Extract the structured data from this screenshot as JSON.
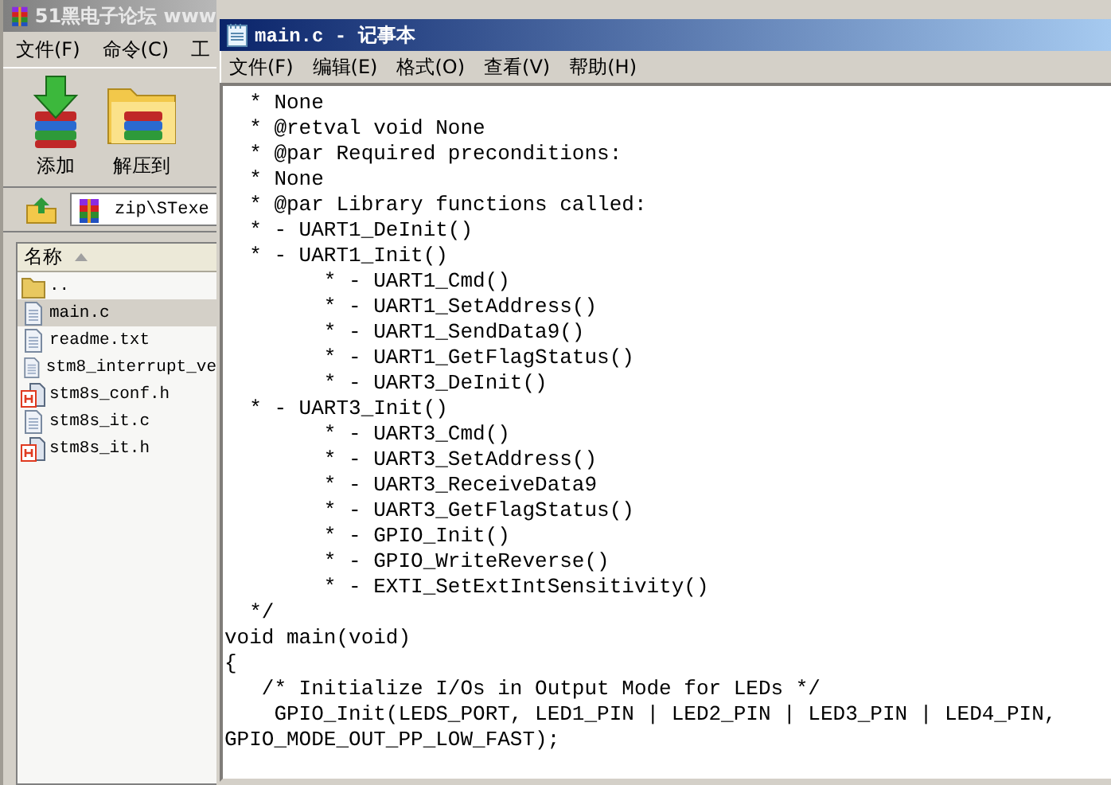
{
  "background_window": {
    "title": "51黑电子论坛 www",
    "menu": [
      "文件(F)",
      "命令(C)",
      "工"
    ],
    "toolbar": [
      {
        "label": "添加",
        "kind": "add"
      },
      {
        "label": "解压到",
        "kind": "extract"
      }
    ],
    "path": "zip\\STexe",
    "column": "名称",
    "files": [
      {
        "name": "..",
        "kind": "folder",
        "selected": false
      },
      {
        "name": "main.c",
        "kind": "text",
        "selected": true
      },
      {
        "name": "readme.txt",
        "kind": "text",
        "selected": false
      },
      {
        "name": "stm8_interrupt_ve",
        "kind": "text",
        "selected": false
      },
      {
        "name": "stm8s_conf.h",
        "kind": "header",
        "selected": false
      },
      {
        "name": "stm8s_it.c",
        "kind": "text",
        "selected": false
      },
      {
        "name": "stm8s_it.h",
        "kind": "header",
        "selected": false
      }
    ]
  },
  "notepad": {
    "title": "main.c - 记事本",
    "menu": [
      "文件(F)",
      "编辑(E)",
      "格式(O)",
      "查看(V)",
      "帮助(H)"
    ],
    "lines": [
      "  * None",
      "  * @retval void None",
      "  * @par Required preconditions:",
      "  * None",
      "  * @par Library functions called:",
      "  * - UART1_DeInit()",
      "  * - UART1_Init()",
      "        * - UART1_Cmd()",
      "        * - UART1_SetAddress()",
      "        * - UART1_SendData9()",
      "        * - UART1_GetFlagStatus()",
      "        * - UART3_DeInit()",
      "  * - UART3_Init()",
      "        * - UART3_Cmd()",
      "        * - UART3_SetAddress()",
      "        * - UART3_ReceiveData9",
      "        * - UART3_GetFlagStatus()",
      "        * - GPIO_Init()",
      "        * - GPIO_WriteReverse()",
      "        * - EXTI_SetExtIntSensitivity()",
      "  */",
      "void main(void)",
      "{",
      "   /* Initialize I/Os in Output Mode for LEDs */",
      "    GPIO_Init(LEDS_PORT, LED1_PIN | LED2_PIN | LED3_PIN | LED4_PIN,",
      "GPIO_MODE_OUT_PP_LOW_FAST);"
    ]
  }
}
